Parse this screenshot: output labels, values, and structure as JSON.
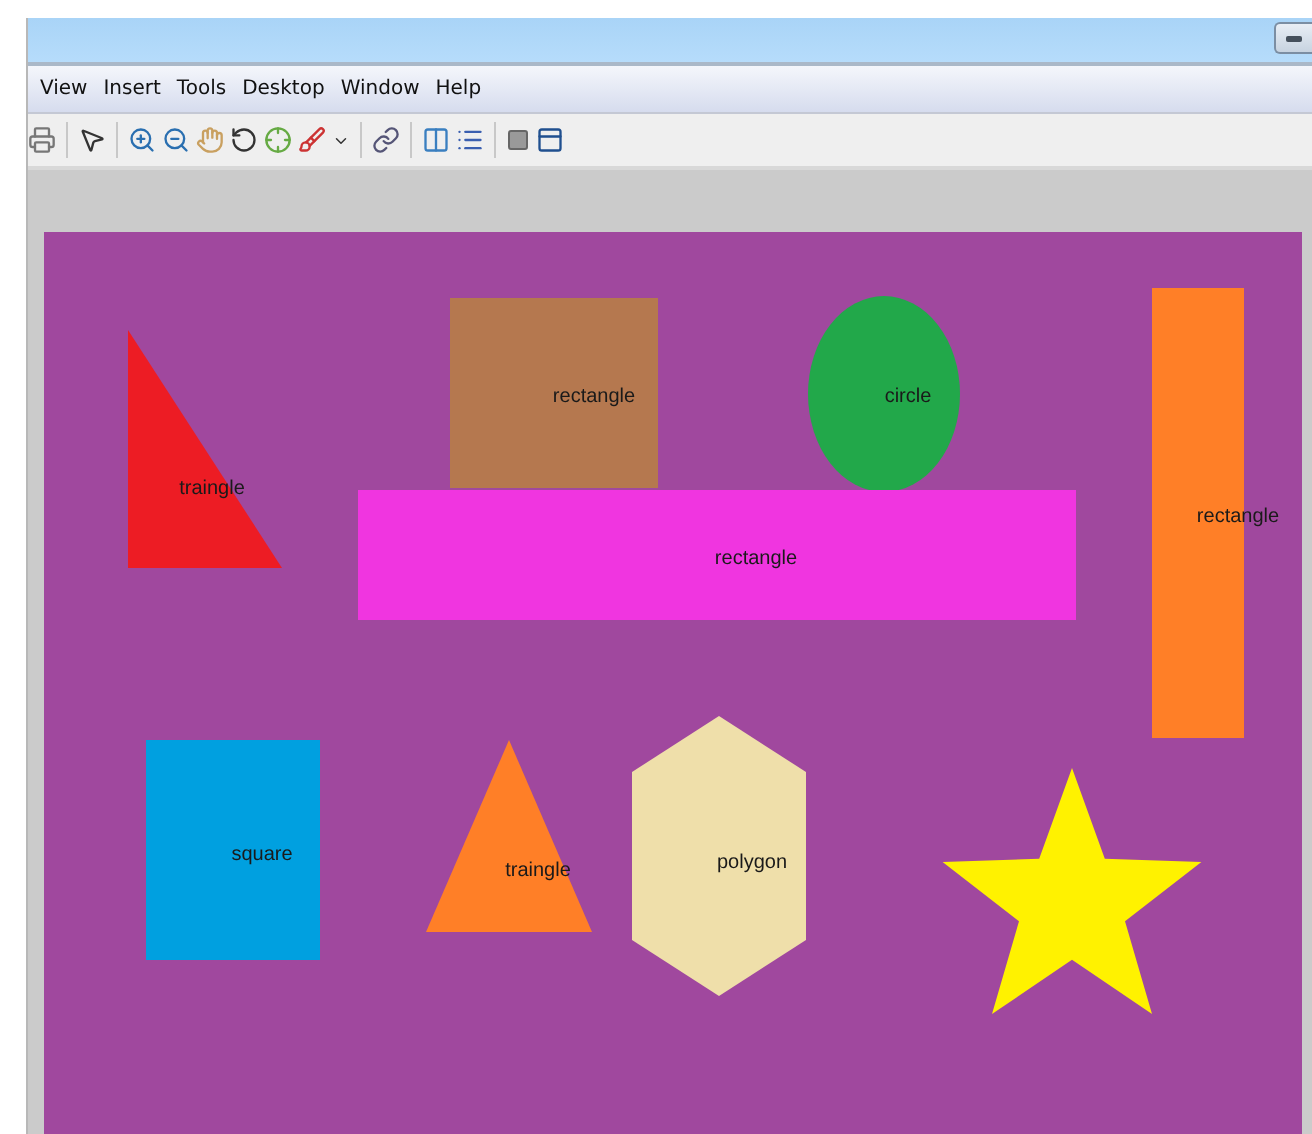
{
  "menu": [
    "View",
    "Insert",
    "Tools",
    "Desktop",
    "Window",
    "Help"
  ],
  "shapes": [
    {
      "kind": "triangle",
      "label": "traingle",
      "color": "#ed1c24"
    },
    {
      "kind": "rectangle",
      "label": "rectangle",
      "color": "#b5784f"
    },
    {
      "kind": "circle",
      "label": "circle",
      "color": "#22a84a"
    },
    {
      "kind": "rectangle",
      "label": "rectangle",
      "color": "#f035e0"
    },
    {
      "kind": "rectangle",
      "label": "rectangle",
      "color": "#ff7f27"
    },
    {
      "kind": "square",
      "label": "square",
      "color": "#00a0e0"
    },
    {
      "kind": "triangle",
      "label": "traingle",
      "color": "#ff7f27"
    },
    {
      "kind": "polygon",
      "label": "polygon",
      "color": "#efdfaa"
    },
    {
      "kind": "star",
      "color": "#fff200"
    }
  ]
}
